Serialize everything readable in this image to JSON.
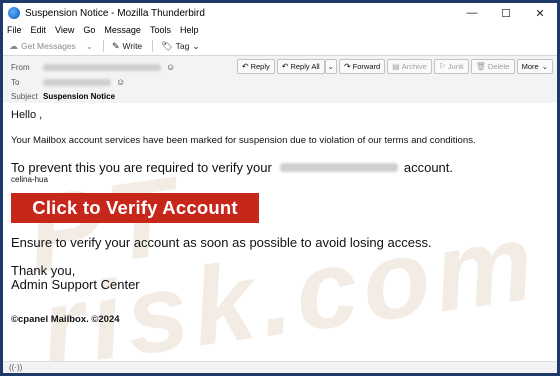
{
  "window": {
    "title": "Suspension Notice - Mozilla Thunderbird",
    "minimize": "—",
    "maximize": "☐",
    "close": "✕"
  },
  "menu": {
    "file": "File",
    "edit": "Edit",
    "view": "View",
    "go": "Go",
    "message": "Message",
    "tools": "Tools",
    "help": "Help"
  },
  "toolbar": {
    "get_messages": "Get Messages",
    "write": "Write",
    "tag": "Tag"
  },
  "header": {
    "from_label": "From",
    "to_label": "To",
    "subject_label": "Subject",
    "subject_value": "Suspension Notice",
    "actions": {
      "reply": "Reply",
      "reply_all": "Reply All",
      "forward": "Forward",
      "archive": "Archive",
      "junk": "Junk",
      "delete": "Delete",
      "more": "More"
    }
  },
  "email": {
    "greeting": "Hello ,",
    "line1": "Your Mailbox account services have been marked for suspension due to violation of our terms and conditions.",
    "line2_a": "To prevent this you are required to verify your",
    "line2_b": "account.",
    "username": "celina-hua",
    "cta": "Click to Verify Account",
    "line3": "Ensure to verify your account as soon as possible to avoid losing access.",
    "thanks": "Thank you,",
    "signature": "Admin Support Center",
    "footer": "©cpanel  Mailbox. ©2024",
    "watermark": "PT\nrisk.com"
  },
  "statusbar": {
    "icon": "((·))"
  }
}
